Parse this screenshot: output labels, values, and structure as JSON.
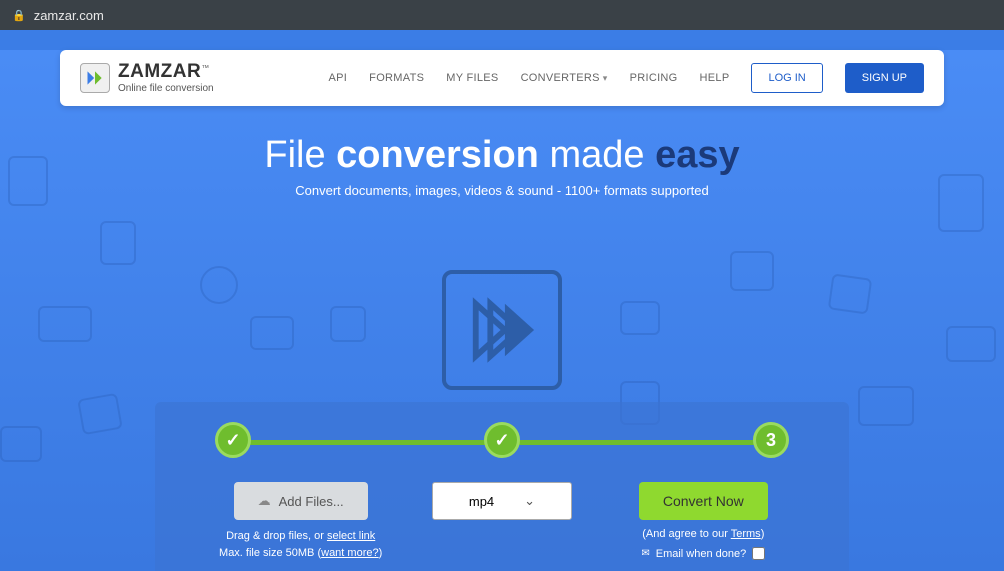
{
  "url_bar": {
    "domain": "zamzar.com"
  },
  "brand": {
    "name": "ZAMZAR",
    "tagline": "Online file conversion",
    "tm": "™"
  },
  "nav": {
    "api": "API",
    "formats": "FORMATS",
    "my_files": "MY FILES",
    "converters": "CONVERTERS",
    "pricing": "PRICING",
    "help": "HELP",
    "login": "LOG IN",
    "signup": "SIGN UP"
  },
  "hero": {
    "t1": "File",
    "t2": "conversion",
    "t3": "made",
    "t4": "easy",
    "subtitle": "Convert documents, images, videos & sound - 1100+ formats supported"
  },
  "steps": {
    "current": "3"
  },
  "controls": {
    "add_files": "Add Files...",
    "drag_hint_pre": "Drag & drop files, or ",
    "drag_hint_link": "select link",
    "size_hint_pre": "Max. file size 50MB (",
    "size_hint_link": "want more?",
    "size_hint_post": ")",
    "selected_format": "mp4",
    "convert": "Convert Now",
    "agree_pre": "(And agree to our ",
    "agree_link": "Terms",
    "agree_post": ")",
    "email_label": "Email when done?"
  }
}
